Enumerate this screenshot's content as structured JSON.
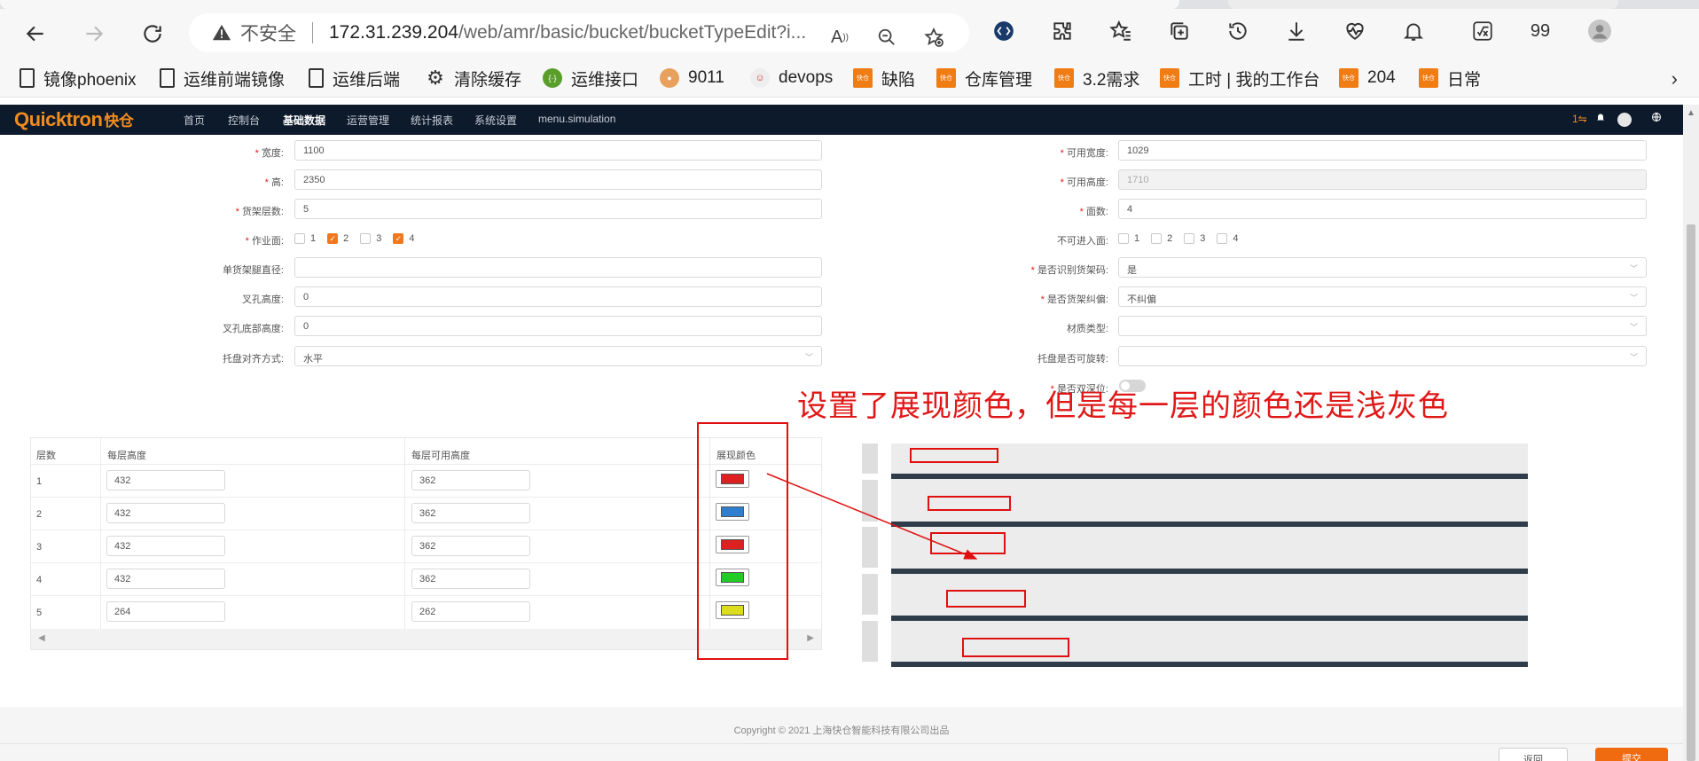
{
  "browser": {
    "address": {
      "insecure_label": "不安全",
      "url_host": "172.31.239.204",
      "url_path": "/web/amr/basic/bucket/bucketTypeEdit?i..."
    },
    "toolbar": {
      "badge_count": "99"
    },
    "bookmarks": [
      {
        "label": "镜像phoenix",
        "icon": "page-icon"
      },
      {
        "label": "运维前端镜像",
        "icon": "page-icon"
      },
      {
        "label": "运维后端",
        "icon": "page-icon"
      },
      {
        "label": "清除缓存",
        "icon": "gear-icon"
      },
      {
        "label": "运维接口",
        "icon": "api-icon"
      },
      {
        "label": "9011",
        "icon": "site-icon"
      },
      {
        "label": "devops",
        "icon": "avatar-icon"
      },
      {
        "label": "缺陷",
        "icon": "quicktron-icon"
      },
      {
        "label": "仓库管理",
        "icon": "quicktron-icon"
      },
      {
        "label": "3.2需求",
        "icon": "quicktron-icon"
      },
      {
        "label": "工时 | 我的工作台",
        "icon": "quicktron-icon"
      },
      {
        "label": "204",
        "icon": "quicktron-icon"
      },
      {
        "label": "日常",
        "icon": "quicktron-icon"
      }
    ]
  },
  "app": {
    "logo": "Quicktron",
    "logo_cn": "快仓",
    "menu": [
      {
        "label": "首页"
      },
      {
        "label": "控制台"
      },
      {
        "label": "基础数据"
      },
      {
        "label": "运营管理"
      },
      {
        "label": "统计报表"
      },
      {
        "label": "系统设置"
      },
      {
        "label": "menu.simulation"
      }
    ],
    "header_right": {
      "count": "1⇋"
    }
  },
  "form": {
    "left": [
      {
        "label": "宽度:",
        "required": true,
        "value": "1100"
      },
      {
        "label": "高:",
        "required": true,
        "value": "2350"
      },
      {
        "label": "货架层数:",
        "required": true,
        "value": "5"
      },
      {
        "label": "作业面:",
        "required": true
      },
      {
        "label": "单货架腿直径:",
        "required": false,
        "value": ""
      },
      {
        "label": "叉孔高度:",
        "required": false,
        "value": "0"
      },
      {
        "label": "叉孔底部高度:",
        "required": false,
        "value": "0"
      },
      {
        "label": "托盘对齐方式:",
        "required": false,
        "value": "水平"
      }
    ],
    "right": [
      {
        "label": "可用宽度:",
        "required": true,
        "value": "1029"
      },
      {
        "label": "可用高度:",
        "required": true,
        "value": "1710"
      },
      {
        "label": "面数:",
        "required": true,
        "value": "4"
      },
      {
        "label": "不可进入面:",
        "required": false
      },
      {
        "label": "是否识别货架码:",
        "required": true,
        "value": "是"
      },
      {
        "label": "是否货架纠偏:",
        "required": true,
        "value": "不纠偏"
      },
      {
        "label": "材质类型:",
        "required": false,
        "value": ""
      },
      {
        "label": "托盘是否可旋转:",
        "required": false,
        "value": ""
      },
      {
        "label": "是否双深位:",
        "required": true
      }
    ],
    "work_faces": [
      {
        "label": "1",
        "checked": false
      },
      {
        "label": "2",
        "checked": true
      },
      {
        "label": "3",
        "checked": false
      },
      {
        "label": "4",
        "checked": true
      }
    ],
    "no_entry_faces": [
      {
        "label": "1",
        "checked": false
      },
      {
        "label": "2",
        "checked": false
      },
      {
        "label": "3",
        "checked": false
      },
      {
        "label": "4",
        "checked": false
      }
    ]
  },
  "table": {
    "headers": [
      "层数",
      "每层高度",
      "每层可用高度",
      "展现颜色"
    ],
    "rows": [
      {
        "layer": "1",
        "height": "432",
        "usable": "362",
        "color": "#e02020"
      },
      {
        "layer": "2",
        "height": "432",
        "usable": "362",
        "color": "#2f7fd0"
      },
      {
        "layer": "3",
        "height": "432",
        "usable": "362",
        "color": "#e02020"
      },
      {
        "layer": "4",
        "height": "432",
        "usable": "362",
        "color": "#22cc22"
      },
      {
        "layer": "5",
        "height": "264",
        "usable": "262",
        "color": "#dddd20"
      }
    ]
  },
  "annotation": {
    "text": "设置了展现颜色，但是每一层的颜色还是浅灰色",
    "color": "#e01010"
  },
  "shelf_preview": {
    "layers": 5,
    "layer_color": "#ececec",
    "bar_color": "#2f3d4a"
  },
  "footer": {
    "copyright": "Copyright © 2021 上海快仓智能科技有限公司出品",
    "back_label": "返回",
    "submit_label": "提交"
  }
}
